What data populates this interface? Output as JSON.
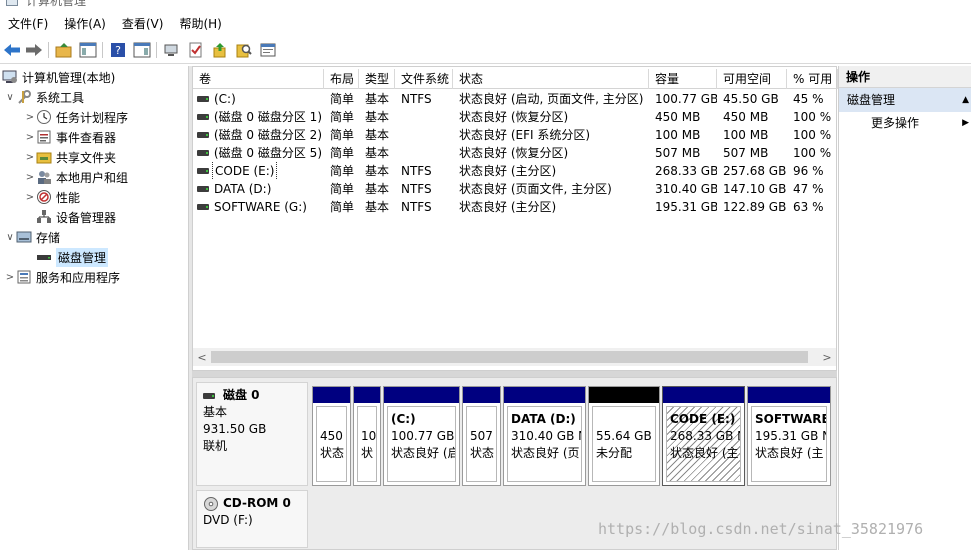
{
  "window": {
    "title": "计算机管理"
  },
  "menu": [
    "文件(F)",
    "操作(A)",
    "查看(V)",
    "帮助(H)"
  ],
  "toolbar_icons": [
    "back-arrow-icon",
    "forward-arrow-icon",
    "up-folder-icon",
    "show-tree-icon",
    "help-icon",
    "show-action-pane-icon",
    "connect-icon",
    "check-icon",
    "export-icon",
    "search-icon",
    "properties-icon"
  ],
  "tree": [
    {
      "label": "计算机管理(本地)",
      "caret": "",
      "icon": "computer-management-icon",
      "level": 0
    },
    {
      "label": "系统工具",
      "caret": "∨",
      "icon": "system-tools-icon",
      "level": 1
    },
    {
      "label": "任务计划程序",
      "caret": ">",
      "icon": "task-scheduler-icon",
      "level": 2
    },
    {
      "label": "事件查看器",
      "caret": ">",
      "icon": "event-viewer-icon",
      "level": 2
    },
    {
      "label": "共享文件夹",
      "caret": ">",
      "icon": "shared-folders-icon",
      "level": 2
    },
    {
      "label": "本地用户和组",
      "caret": ">",
      "icon": "local-users-icon",
      "level": 2
    },
    {
      "label": "性能",
      "caret": ">",
      "icon": "performance-icon",
      "level": 2
    },
    {
      "label": "设备管理器",
      "caret": "",
      "icon": "device-manager-icon",
      "level": 2
    },
    {
      "label": "存储",
      "caret": "∨",
      "icon": "storage-icon",
      "level": 1
    },
    {
      "label": "磁盘管理",
      "caret": "",
      "icon": "disk-management-icon",
      "level": 2,
      "selected": true
    },
    {
      "label": "服务和应用程序",
      "caret": ">",
      "icon": "services-apps-icon",
      "level": 1
    }
  ],
  "volume_table": {
    "headers": [
      "卷",
      "布局",
      "类型",
      "文件系统",
      "状态",
      "容量",
      "可用空间",
      "% 可用"
    ],
    "rows": [
      [
        "(C:)",
        "简单",
        "基本",
        "NTFS",
        "状态良好 (启动, 页面文件, 主分区)",
        "100.77 GB",
        "45.50 GB",
        "45 %"
      ],
      [
        "(磁盘 0 磁盘分区 1)",
        "简单",
        "基本",
        "",
        "状态良好 (恢复分区)",
        "450 MB",
        "450 MB",
        "100 %"
      ],
      [
        "(磁盘 0 磁盘分区 2)",
        "简单",
        "基本",
        "",
        "状态良好 (EFI 系统分区)",
        "100 MB",
        "100 MB",
        "100 %"
      ],
      [
        "(磁盘 0 磁盘分区 5)",
        "简单",
        "基本",
        "",
        "状态良好 (恢复分区)",
        "507 MB",
        "507 MB",
        "100 %"
      ],
      [
        "CODE (E:)",
        "简单",
        "基本",
        "NTFS",
        "状态良好 (主分区)",
        "268.33 GB",
        "257.68 GB",
        "96 %"
      ],
      [
        "DATA (D:)",
        "简单",
        "基本",
        "NTFS",
        "状态良好 (页面文件, 主分区)",
        "310.40 GB",
        "147.10 GB",
        "47 %"
      ],
      [
        "SOFTWARE (G:)",
        "简单",
        "基本",
        "NTFS",
        "状态良好 (主分区)",
        "195.31 GB",
        "122.89 GB",
        "63 %"
      ]
    ]
  },
  "scroll": {
    "left": "<",
    "right": ">"
  },
  "disks": [
    {
      "name": "磁盘 0",
      "type": "基本",
      "size": "931.50 GB",
      "status": "联机",
      "partitions": [
        {
          "title": "",
          "line1": "450",
          "line2": "状态",
          "bar": "blue"
        },
        {
          "title": "",
          "line1": "10",
          "line2": "状",
          "bar": "blue"
        },
        {
          "title": "(C:)",
          "line1": "100.77 GB",
          "line2": "状态良好 (启",
          "bar": "blue"
        },
        {
          "title": "",
          "line1": "507",
          "line2": "状态",
          "bar": "blue"
        },
        {
          "title": "DATA  (D:)",
          "line1": "310.40 GB N",
          "line2": "状态良好 (页",
          "bar": "blue"
        },
        {
          "title": "",
          "line1": "55.64 GB",
          "line2": "未分配",
          "bar": "black"
        },
        {
          "title": "CODE  (E:)",
          "line1": "268.33 GB N",
          "line2": "状态良好 (主",
          "bar": "blue",
          "selected": true
        },
        {
          "title": "SOFTWARE",
          "line1": "195.31 GB N",
          "line2": "状态良好 (主",
          "bar": "blue"
        }
      ]
    },
    {
      "name": "CD-ROM 0",
      "type": "DVD (F:)"
    }
  ],
  "actions": {
    "header": "操作",
    "section": "磁盘管理",
    "more": "更多操作"
  },
  "watermark": "https://blog.csdn.net/sinat_35821976"
}
